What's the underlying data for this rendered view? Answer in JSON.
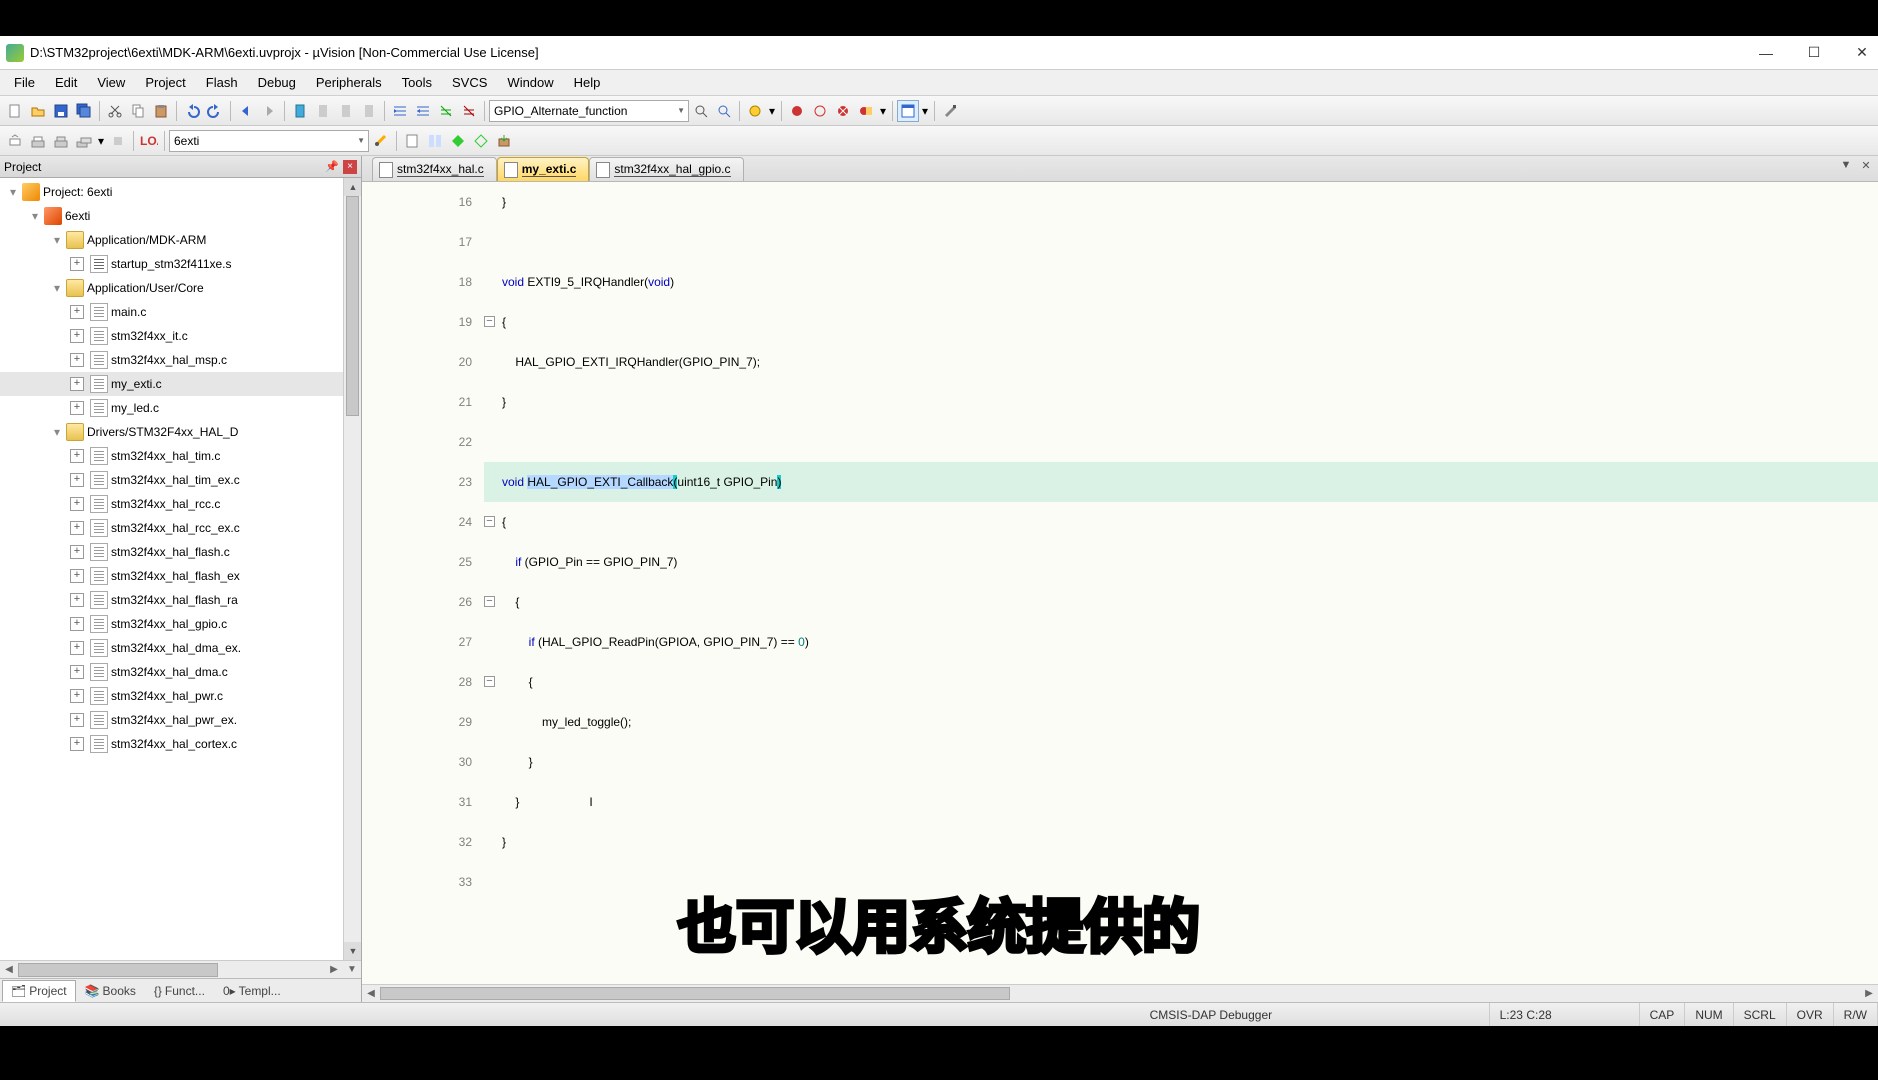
{
  "title": "D:\\STM32project\\6exti\\MDK-ARM\\6exti.uvprojx - µVision  [Non-Commercial Use License]",
  "menus": [
    "File",
    "Edit",
    "View",
    "Project",
    "Flash",
    "Debug",
    "Peripherals",
    "Tools",
    "SVCS",
    "Window",
    "Help"
  ],
  "toolbar": {
    "combo1": "GPIO_Alternate_function"
  },
  "toolbar2": {
    "target": "6exti"
  },
  "projectPanel": {
    "title": "Project"
  },
  "tree": {
    "root": "Project: 6exti",
    "target": "6exti",
    "groups": [
      {
        "name": "Application/MDK-ARM",
        "files": [
          "startup_stm32f411xe.s"
        ],
        "asm": true
      },
      {
        "name": "Application/User/Core",
        "files": [
          "main.c",
          "stm32f4xx_it.c",
          "stm32f4xx_hal_msp.c",
          "my_exti.c",
          "my_led.c"
        ],
        "selectedIndex": 3
      },
      {
        "name": "Drivers/STM32F4xx_HAL_D",
        "files": [
          "stm32f4xx_hal_tim.c",
          "stm32f4xx_hal_tim_ex.c",
          "stm32f4xx_hal_rcc.c",
          "stm32f4xx_hal_rcc_ex.c",
          "stm32f4xx_hal_flash.c",
          "stm32f4xx_hal_flash_ex",
          "stm32f4xx_hal_flash_ra",
          "stm32f4xx_hal_gpio.c",
          "stm32f4xx_hal_dma_ex.",
          "stm32f4xx_hal_dma.c",
          "stm32f4xx_hal_pwr.c",
          "stm32f4xx_hal_pwr_ex.",
          "stm32f4xx_hal_cortex.c"
        ]
      }
    ]
  },
  "panelTabs": [
    "Project",
    "Books",
    "Funct...",
    "Templ..."
  ],
  "editorTabs": [
    {
      "label": "stm32f4xx_hal.c",
      "active": false
    },
    {
      "label": "my_exti.c",
      "active": true
    },
    {
      "label": "stm32f4xx_hal_gpio.c",
      "active": false
    }
  ],
  "code": {
    "startLine": 16,
    "callbackName": "HAL_GPIO_EXTI_Callback",
    "lines": {
      "l16": "}",
      "l18a": "void",
      "l18b": " EXTI9_5_IRQHandler(",
      "l18c": "void",
      "l18d": ")",
      "l19": "{",
      "l20": "    HAL_GPIO_EXTI_IRQHandler(GPIO_PIN_7);",
      "l21": "}",
      "l23a": "void ",
      "l23b": "(",
      "l23c": "uint16_t GPIO_Pin",
      "l23d": ")",
      "l24": "{",
      "l25a": "    ",
      "l25b": "if",
      "l25c": " (GPIO_Pin == GPIO_PIN_7)",
      "l26": "    {",
      "l27a": "        ",
      "l27b": "if",
      "l27c": " (HAL_GPIO_ReadPin(GPIOA, GPIO_PIN_7) == ",
      "l27d": "0",
      "l27e": ")",
      "l28": "        {",
      "l29": "            my_led_toggle();",
      "l30": "        }",
      "l31": "    }",
      "l32": "}"
    }
  },
  "status": {
    "debugger": "CMSIS-DAP Debugger",
    "pos": "L:23 C:28",
    "flags": [
      "CAP",
      "NUM",
      "SCRL",
      "OVR",
      "R/W"
    ]
  },
  "subtitle": "也可以用系统提供的"
}
